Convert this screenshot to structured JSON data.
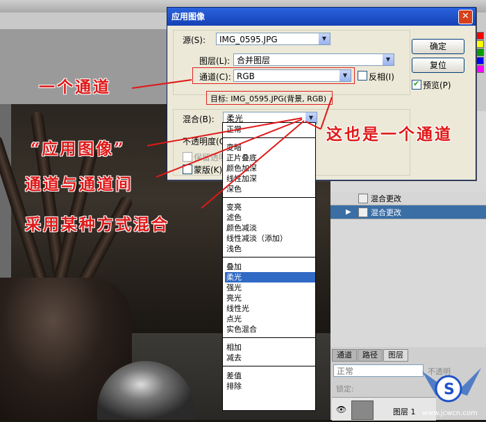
{
  "dialog": {
    "title": "应用图像",
    "source_label": "源(S):",
    "source_value": "IMG_0595.JPG",
    "layer_label": "图层(L):",
    "layer_value": "合并图层",
    "channel_label": "通道(C):",
    "channel_value": "RGB",
    "invert_label": "反相(I)",
    "target_text": "目标: IMG_0595.JPG(背景, RGB)",
    "blend_label": "混合(B):",
    "blend_value": "柔光",
    "opacity_label": "不透明度(O",
    "preserve_label": "保留透明",
    "mask_label": "蒙版(K)...",
    "ok_label": "确定",
    "reset_label": "复位",
    "preview_label": "预览(P)"
  },
  "blend_menu": {
    "groups": [
      [
        "正常"
      ],
      [
        "变暗",
        "正片叠底",
        "颜色加深",
        "线性加深",
        "深色"
      ],
      [
        "变亮",
        "滤色",
        "颜色减淡",
        "线性减淡（添加）",
        "浅色"
      ],
      [
        "叠加",
        "柔光",
        "强光",
        "亮光",
        "线性光",
        "点光",
        "实色混合"
      ],
      [
        "相加",
        "减去"
      ],
      [
        "差值",
        "排除"
      ]
    ],
    "selected": "柔光"
  },
  "annotations": {
    "one_channel": "一个通道",
    "also_channel": "这也是一个通道",
    "apply_image": "“应用图像”",
    "between_channels": "通道与通道间",
    "blend_mode": "采用某种方式混合"
  },
  "history": {
    "items": [
      "混合更改",
      "混合更改"
    ]
  },
  "layers_panel": {
    "tabs": [
      "通道",
      "路径",
      "图层"
    ],
    "blend_value": "正常",
    "opacity_label": "不透明",
    "lock_label": "锁定:",
    "layer_name": "图层 1"
  },
  "watermark": {
    "site": "www.jcwcn.com"
  },
  "colors": {
    "annotation_red": "#e01818",
    "selection_blue": "#316ac5",
    "titlebar_blue": "#1f52c8"
  }
}
